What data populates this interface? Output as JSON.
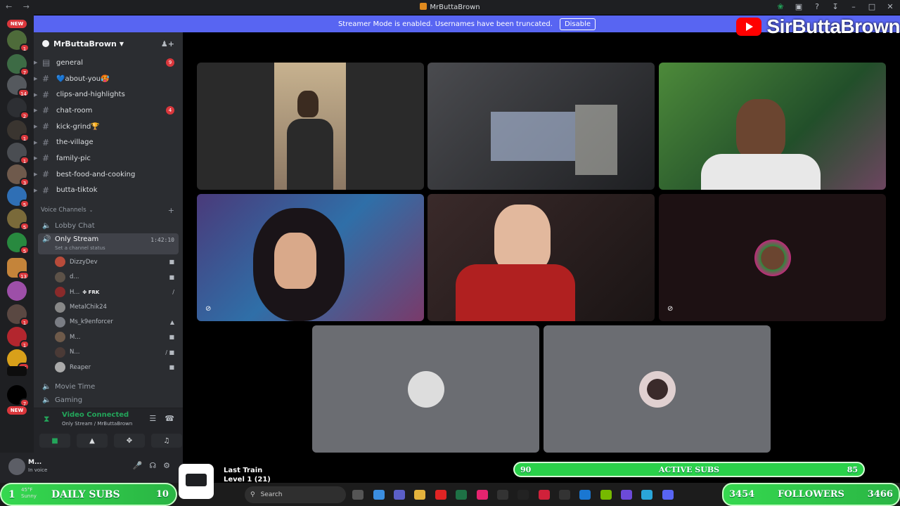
{
  "window": {
    "title": "MrButtaBrown",
    "nav_glyphs": "← →"
  },
  "banner": {
    "message": "Streamer Mode is enabled. Usernames have been truncated.",
    "button": "Disable"
  },
  "overlay": {
    "youtube_name": "SirButtaBrown",
    "song_title": "Last Train",
    "song_level": "Level 1 (21)",
    "active_subs_left": "90",
    "active_subs_label": "ACTIVE SUBS",
    "active_subs_right": "85",
    "daily_subs_left": "1",
    "daily_subs_label": "DAILY SUBS",
    "daily_subs_right": "10",
    "followers_left": "3454",
    "followers_label": "FOLLOWERS",
    "followers_right": "3466"
  },
  "rail": {
    "new_tag": "NEW",
    "badges": [
      "1",
      "7",
      "14",
      "2",
      "1",
      "1",
      "3",
      "5",
      "5",
      "5",
      "13",
      "1",
      "1",
      "15",
      "7"
    ]
  },
  "server": {
    "name": "MrButtaBrown",
    "channels": [
      {
        "name": "general",
        "badge": "9",
        "icon": "rules-icon"
      },
      {
        "name": "💙about-you🥵",
        "badge": ""
      },
      {
        "name": "clips-and-highlights",
        "badge": ""
      },
      {
        "name": "chat-room",
        "badge": "4"
      },
      {
        "name": "kick-grind🏆",
        "badge": ""
      },
      {
        "name": "the-village",
        "badge": ""
      },
      {
        "name": "family-pic",
        "badge": ""
      },
      {
        "name": "best-food-and-cooking",
        "badge": ""
      },
      {
        "name": "butta-tiktok",
        "badge": ""
      }
    ],
    "voice_category": "Voice Channels",
    "voice_channels": {
      "lobby": "Lobby Chat",
      "active": "Only Stream",
      "active_timer": "1:42:10",
      "active_status": "Set a channel status",
      "movie": "Movie Time",
      "gaming": "Gaming"
    },
    "members": [
      {
        "name": "DizzyDev",
        "tag": "",
        "icon": "■"
      },
      {
        "name": "d...",
        "tag": "",
        "icon": "■"
      },
      {
        "name": "H...",
        "tag": "✤ FRK",
        "icon": "∕"
      },
      {
        "name": "MetalChik24",
        "tag": "",
        "icon": ""
      },
      {
        "name": "Ms_k9enforcer",
        "tag": "",
        "icon": "▲"
      },
      {
        "name": "M...",
        "tag": "",
        "icon": "■"
      },
      {
        "name": "N...",
        "tag": "",
        "icon": "∕ ■"
      },
      {
        "name": "Reaper",
        "tag": "",
        "icon": "■"
      }
    ]
  },
  "voice_panel": {
    "title": "Video Connected",
    "subtitle": "Only Stream / MrButtaBrown"
  },
  "user": {
    "name": "M...",
    "status": "In voice"
  },
  "taskbar": {
    "search_placeholder": "Search",
    "weather_temp": "45°F",
    "weather_desc": "Sunny"
  },
  "tiles": [
    {
      "kind": "camera",
      "label": "cam-1"
    },
    {
      "kind": "camera",
      "label": "cam-2"
    },
    {
      "kind": "camera",
      "label": "cam-3"
    },
    {
      "kind": "camera",
      "label": "cam-4"
    },
    {
      "kind": "camera",
      "label": "cam-5"
    },
    {
      "kind": "avatar",
      "label": "avatar-6"
    },
    {
      "kind": "avatar",
      "label": "avatar-7"
    },
    {
      "kind": "avatar",
      "label": "avatar-8"
    }
  ]
}
